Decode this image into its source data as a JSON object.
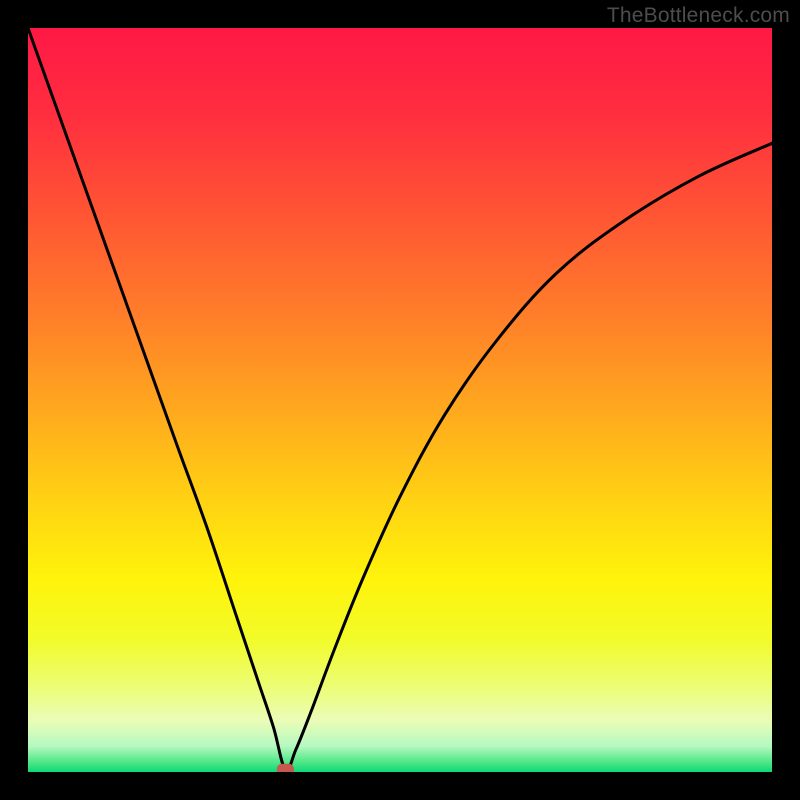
{
  "watermark": "TheBottleneck.com",
  "chart_data": {
    "type": "line",
    "title": "",
    "xlabel": "",
    "ylabel": "",
    "xlim": [
      0,
      100
    ],
    "ylim": [
      0,
      100
    ],
    "grid": false,
    "legend": false,
    "series": [
      {
        "name": "curve",
        "x": [
          0,
          5,
          10,
          15,
          20,
          24,
          28,
          31,
          33,
          34.6,
          36,
          38,
          41,
          45,
          50,
          56,
          63,
          71,
          80,
          90,
          100
        ],
        "y": [
          100,
          86,
          72,
          58,
          44,
          33,
          21,
          12,
          6,
          0.3,
          3,
          8,
          16,
          26,
          37,
          48,
          58,
          67,
          74,
          80,
          84.5
        ]
      }
    ],
    "marker": {
      "x": 34.6,
      "y": 0.3,
      "color": "#c6594e"
    },
    "background_gradient": {
      "stops": [
        {
          "pos": 0.0,
          "color": "#ff1845"
        },
        {
          "pos": 0.12,
          "color": "#ff2f3f"
        },
        {
          "pos": 0.25,
          "color": "#ff5534"
        },
        {
          "pos": 0.38,
          "color": "#ff7c2a"
        },
        {
          "pos": 0.5,
          "color": "#ffa41f"
        },
        {
          "pos": 0.62,
          "color": "#ffcd14"
        },
        {
          "pos": 0.74,
          "color": "#fff30b"
        },
        {
          "pos": 0.82,
          "color": "#f2fb28"
        },
        {
          "pos": 0.88,
          "color": "#ecfd6e"
        },
        {
          "pos": 0.93,
          "color": "#ebfdb6"
        },
        {
          "pos": 0.965,
          "color": "#b6f9c1"
        },
        {
          "pos": 0.985,
          "color": "#57e98a"
        },
        {
          "pos": 1.0,
          "color": "#0dd877"
        }
      ]
    }
  }
}
